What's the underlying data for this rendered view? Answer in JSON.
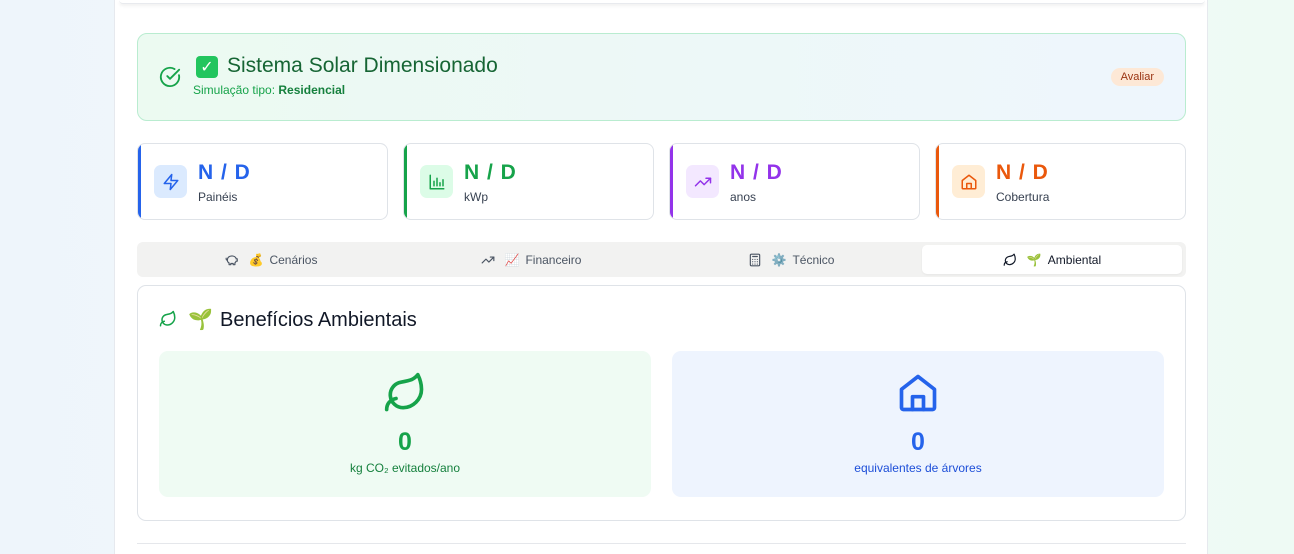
{
  "banner": {
    "check_box": "✓",
    "title": "Sistema Solar Dimensionado",
    "subtitle_prefix": "Simulação tipo: ",
    "subtitle_value": "Residencial",
    "badge": "Avaliar",
    "icon": "circle-check-icon"
  },
  "stats": [
    {
      "value": "N / D",
      "label": "Painéis",
      "icon": "zap-icon",
      "color": "#2563eb"
    },
    {
      "value": "N / D",
      "label": "kWp",
      "icon": "bar-chart-icon",
      "color": "#16a34a"
    },
    {
      "value": "N / D",
      "label": "anos",
      "icon": "trending-up-icon",
      "color": "#9333ea"
    },
    {
      "value": "N / D",
      "label": "Cobertura",
      "icon": "home-icon",
      "color": "#ea580c"
    }
  ],
  "tabs": [
    {
      "emoji": "💰",
      "label": "Cenários",
      "icon": "piggy-bank-icon"
    },
    {
      "emoji": "📈",
      "label": "Financeiro",
      "icon": "trending-up-icon"
    },
    {
      "emoji": "⚙️",
      "label": "Técnico",
      "icon": "calculator-icon"
    },
    {
      "emoji": "🌱",
      "label": "Ambiental",
      "icon": "leaf-icon"
    }
  ],
  "env": {
    "emoji": "🌱",
    "title": "Benefícios Ambientais",
    "co2": {
      "value": "0",
      "label": "kg CO₂ evitados/ano",
      "icon": "leaf-icon"
    },
    "trees": {
      "value": "0",
      "label": "equivalentes de árvores",
      "icon": "home-icon"
    }
  },
  "colors": {
    "green": "#16a34a",
    "blue": "#2563eb",
    "purple": "#9333ea",
    "orange": "#ea580c"
  }
}
